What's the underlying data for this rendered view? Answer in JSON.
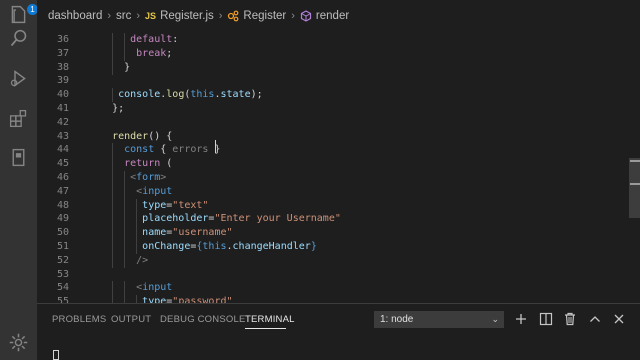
{
  "activity_bar": {
    "source_control_badge": "1"
  },
  "breadcrumb": {
    "items": [
      "dashboard",
      "src",
      "Register.js",
      "Register",
      "render"
    ],
    "file_type_label": "JS"
  },
  "editor": {
    "lines": [
      {
        "n": "36",
        "tokens": [
          {
            "t": "default",
            "c": "tk-kw"
          },
          {
            "t": ":",
            "c": "tk-plain"
          }
        ]
      },
      {
        "n": "37",
        "tokens": [
          {
            "t": "break",
            "c": "tk-kw"
          },
          {
            "t": ";",
            "c": "tk-plain"
          }
        ]
      },
      {
        "n": "38",
        "tokens": [
          {
            "t": "}",
            "c": "tk-plain"
          }
        ]
      },
      {
        "n": "39",
        "tokens": []
      },
      {
        "n": "40",
        "tokens": [
          {
            "t": "console",
            "c": "tk-var"
          },
          {
            "t": ".",
            "c": "tk-plain"
          },
          {
            "t": "log",
            "c": "tk-fn"
          },
          {
            "t": "(",
            "c": "tk-plain"
          },
          {
            "t": "this",
            "c": "tk-this"
          },
          {
            "t": ".",
            "c": "tk-plain"
          },
          {
            "t": "state",
            "c": "tk-var"
          },
          {
            "t": ");",
            "c": "tk-plain"
          }
        ]
      },
      {
        "n": "41",
        "tokens": [
          {
            "t": "};",
            "c": "tk-plain"
          }
        ]
      },
      {
        "n": "42",
        "tokens": []
      },
      {
        "n": "43",
        "tokens": [
          {
            "t": "render",
            "c": "tk-fn"
          },
          {
            "t": "() {",
            "c": "tk-plain"
          }
        ]
      },
      {
        "n": "44",
        "tokens": [
          {
            "t": "const",
            "c": "tk-kw2"
          },
          {
            "t": " { ",
            "c": "tk-plain"
          },
          {
            "t": "errors",
            "c": "tk-punc"
          },
          {
            "t": " } ",
            "c": "tk-plain"
          }
        ]
      },
      {
        "n": "45",
        "tokens": [
          {
            "t": "return",
            "c": "tk-kw"
          },
          {
            "t": " (",
            "c": "tk-plain"
          }
        ]
      },
      {
        "n": "46",
        "tokens": [
          {
            "t": "<",
            "c": "tk-punc"
          },
          {
            "t": "form",
            "c": "tk-tag"
          },
          {
            "t": ">",
            "c": "tk-punc"
          }
        ]
      },
      {
        "n": "47",
        "tokens": [
          {
            "t": "<",
            "c": "tk-punc"
          },
          {
            "t": "input",
            "c": "tk-tag"
          }
        ]
      },
      {
        "n": "48",
        "tokens": [
          {
            "t": "type",
            "c": "tk-attr"
          },
          {
            "t": "=",
            "c": "tk-plain"
          },
          {
            "t": "\"text\"",
            "c": "tk-str"
          }
        ]
      },
      {
        "n": "49",
        "tokens": [
          {
            "t": "placeholder",
            "c": "tk-attr"
          },
          {
            "t": "=",
            "c": "tk-plain"
          },
          {
            "t": "\"Enter your Username\"",
            "c": "tk-str"
          }
        ]
      },
      {
        "n": "50",
        "tokens": [
          {
            "t": "name",
            "c": "tk-attr"
          },
          {
            "t": "=",
            "c": "tk-plain"
          },
          {
            "t": "\"username\"",
            "c": "tk-str"
          }
        ]
      },
      {
        "n": "51",
        "tokens": [
          {
            "t": "onChange",
            "c": "tk-attr"
          },
          {
            "t": "=",
            "c": "tk-plain"
          },
          {
            "t": "{",
            "c": "tk-kw2"
          },
          {
            "t": "this",
            "c": "tk-this"
          },
          {
            "t": ".",
            "c": "tk-plain"
          },
          {
            "t": "changeHandler",
            "c": "tk-var"
          },
          {
            "t": "}",
            "c": "tk-kw2"
          }
        ]
      },
      {
        "n": "52",
        "tokens": [
          {
            "t": "/>",
            "c": "tk-punc"
          }
        ]
      },
      {
        "n": "53",
        "tokens": []
      },
      {
        "n": "54",
        "tokens": [
          {
            "t": "<",
            "c": "tk-punc"
          },
          {
            "t": "input",
            "c": "tk-tag"
          }
        ]
      },
      {
        "n": "55",
        "tokens": [
          {
            "t": "type",
            "c": "tk-attr"
          },
          {
            "t": "=",
            "c": "tk-plain"
          },
          {
            "t": "\"password\"",
            "c": "tk-str"
          }
        ]
      }
    ]
  },
  "panel": {
    "tabs": [
      "PROBLEMS",
      "OUTPUT",
      "DEBUG CONSOLE",
      "TERMINAL"
    ],
    "active_tab": "TERMINAL",
    "terminal_select": "1: node"
  }
}
